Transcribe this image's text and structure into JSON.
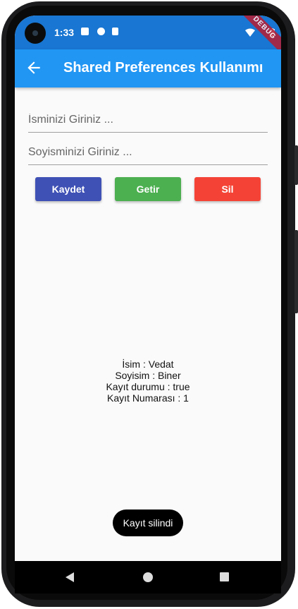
{
  "status_bar": {
    "time": "1:33",
    "debug_banner": "DEBUG"
  },
  "app_bar": {
    "title": "Shared Preferences Kullanımı",
    "back_icon": "arrow-back-icon"
  },
  "form": {
    "name_placeholder": "İsminizi Giriniz ...",
    "surname_placeholder": "Soyisminizi Giriniz ..."
  },
  "buttons": {
    "save": {
      "label": "Kaydet",
      "color": "#3f51b5"
    },
    "fetch": {
      "label": "Getir",
      "color": "#4caf50"
    },
    "delete": {
      "label": "Sil",
      "color": "#f44336"
    }
  },
  "info": {
    "name_line": "İsim : Vedat",
    "surname_line": "Soyisim : Biner",
    "status_line": "Kayıt durumu : true",
    "number_line": "Kayıt Numarası : 1"
  },
  "toast": {
    "message": "Kayıt silindi"
  },
  "colors": {
    "status_bar": "#1976d2",
    "app_bar": "#2196f3",
    "background": "#fafafa"
  }
}
